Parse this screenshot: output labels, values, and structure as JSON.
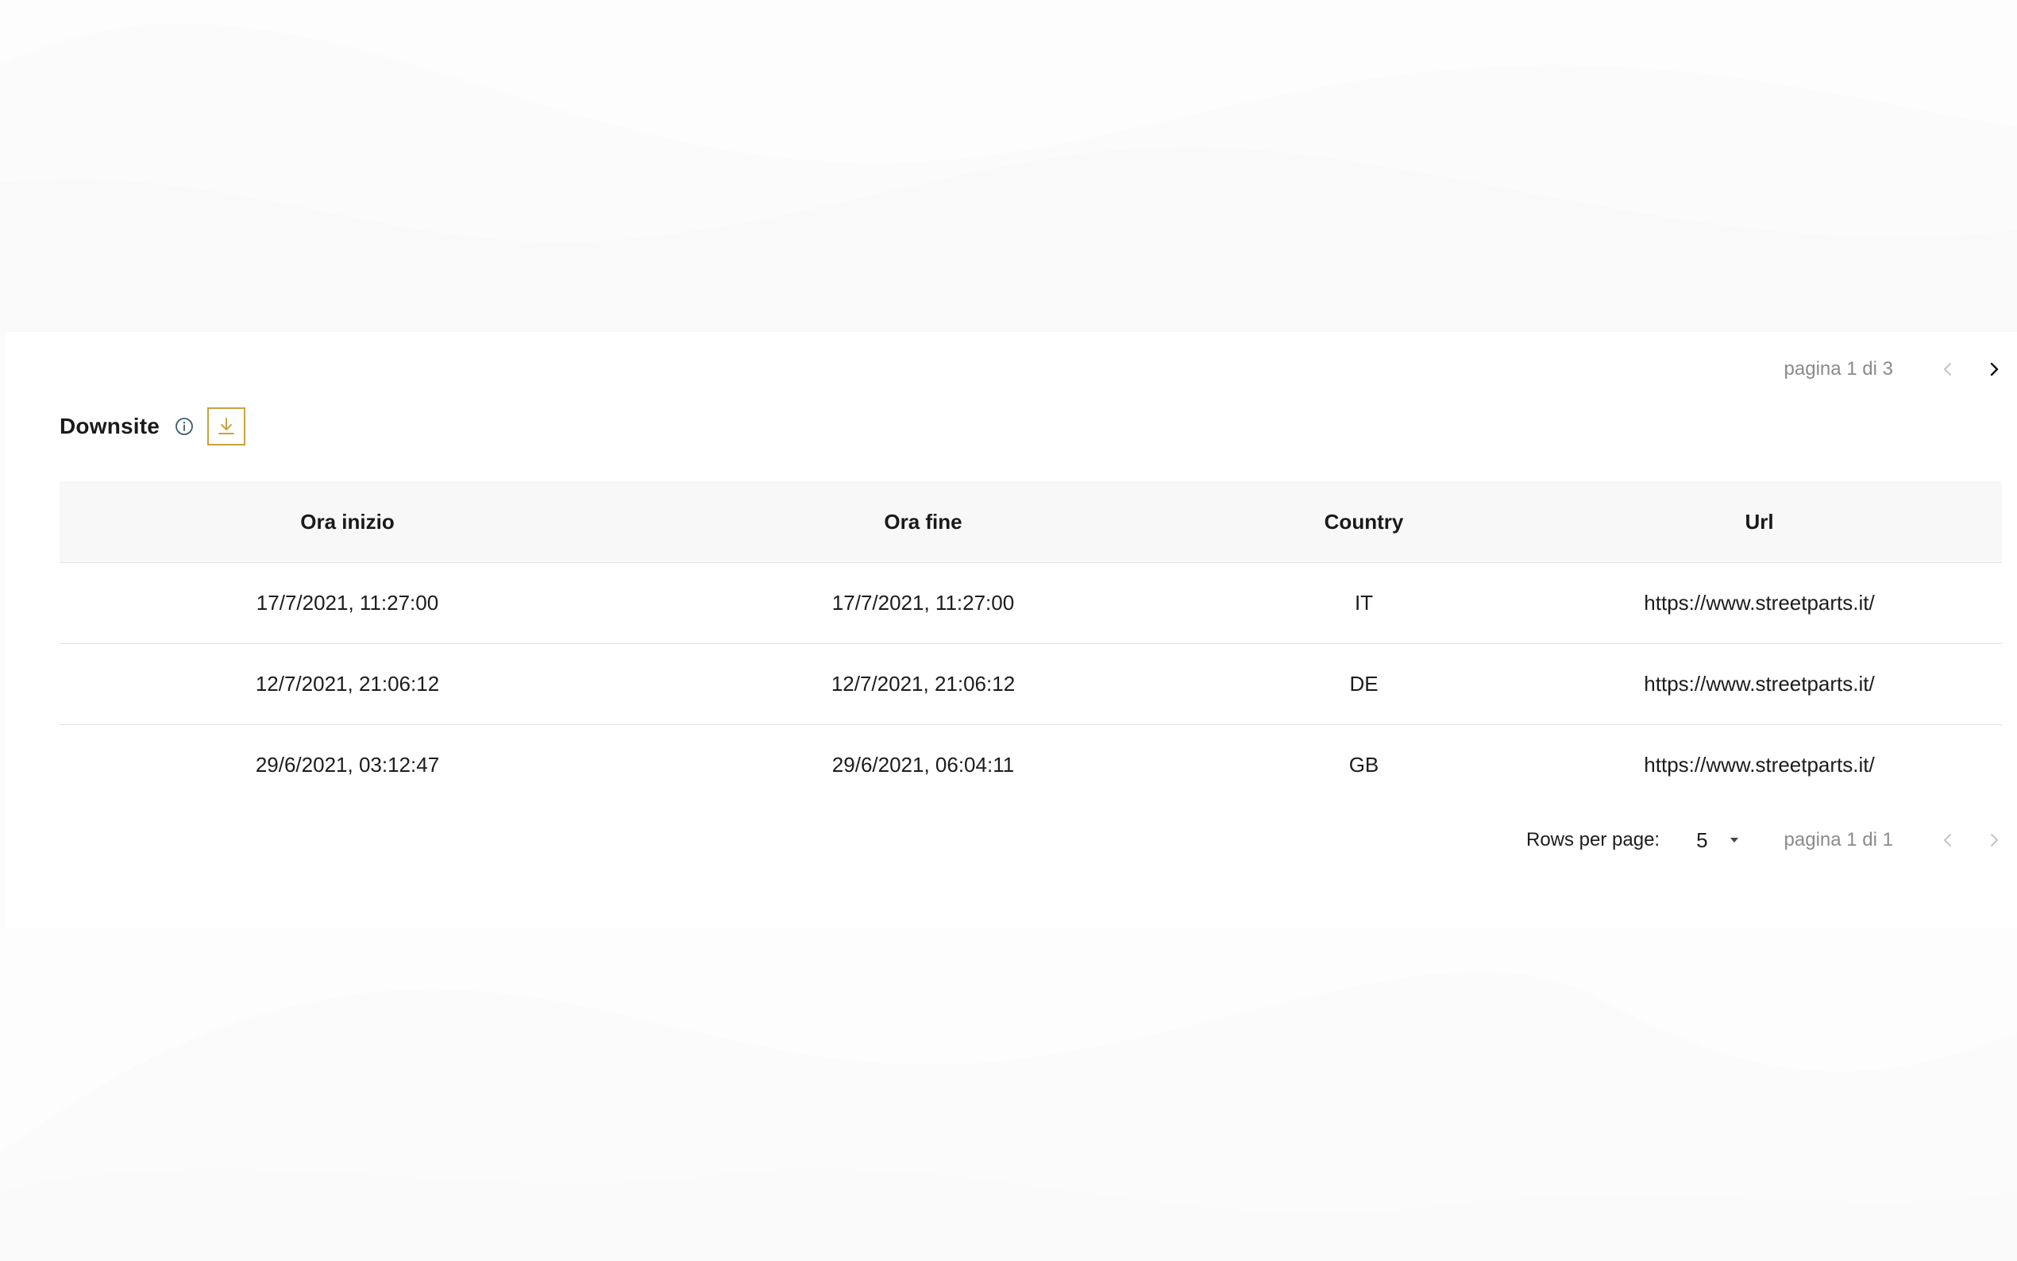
{
  "panel": {
    "title": "Downsite",
    "info_icon": "info-circle-icon",
    "download_icon": "download-icon",
    "accent_color": "#c9a23f"
  },
  "top_pager": {
    "label": "pagina 1 di 3",
    "prev_enabled": false,
    "next_enabled": true
  },
  "table": {
    "columns": [
      "Ora inizio",
      "Ora fine",
      "Country",
      "Url"
    ],
    "rows": [
      [
        "17/7/2021, 11:27:00",
        "17/7/2021, 11:27:00",
        "IT",
        "https://www.streetparts.it/"
      ],
      [
        "12/7/2021, 21:06:12",
        "12/7/2021, 21:06:12",
        "DE",
        "https://www.streetparts.it/"
      ],
      [
        "29/6/2021, 03:12:47",
        "29/6/2021, 06:04:11",
        "GB",
        "https://www.streetparts.it/"
      ]
    ]
  },
  "bottom_pager": {
    "rows_per_page_label": "Rows per page:",
    "rows_per_page_value": "5",
    "label": "pagina 1 di 1",
    "prev_enabled": false,
    "next_enabled": false
  }
}
